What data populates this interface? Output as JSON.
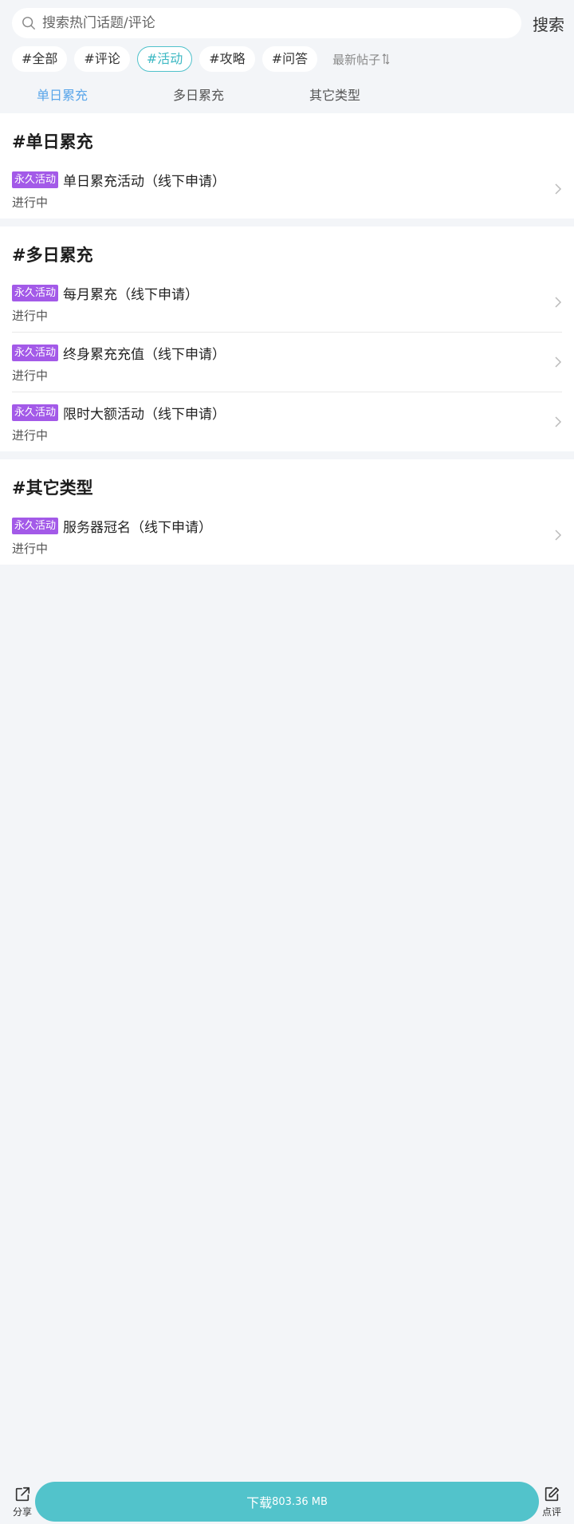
{
  "search": {
    "placeholder": "搜索热门话题/评论",
    "button_label": "搜索"
  },
  "filters": {
    "chips": [
      "#全部",
      "#评论",
      "#活动",
      "#攻略",
      "#问答"
    ],
    "active": "#活动",
    "sort_label": "最新帖子"
  },
  "tabs": {
    "items": [
      "单日累充",
      "多日累充",
      "其它类型"
    ],
    "active": "单日累充"
  },
  "sections": [
    {
      "title": "#单日累充",
      "items": [
        {
          "badge": "永久活动",
          "title": "单日累充活动（线下申请）",
          "status": "进行中"
        }
      ]
    },
    {
      "title": "#多日累充",
      "items": [
        {
          "badge": "永久活动",
          "title": "每月累充（线下申请）",
          "status": "进行中"
        },
        {
          "badge": "永久活动",
          "title": "终身累充充值（线下申请）",
          "status": "进行中"
        },
        {
          "badge": "永久活动",
          "title": "限时大额活动（线下申请）",
          "status": "进行中"
        }
      ]
    },
    {
      "title": "#其它类型",
      "items": [
        {
          "badge": "永久活动",
          "title": "服务器冠名（线下申请）",
          "status": "进行中"
        }
      ]
    }
  ],
  "bottom_bar": {
    "share_label": "分享",
    "download_label": "下载",
    "download_size": "803.36 MB",
    "review_label": "点评"
  },
  "colors": {
    "accent_teal": "#52c3cb",
    "tab_active_blue": "#5aa6ea",
    "badge_purple": "#a35ae8",
    "page_background": "#f3f5f8"
  }
}
